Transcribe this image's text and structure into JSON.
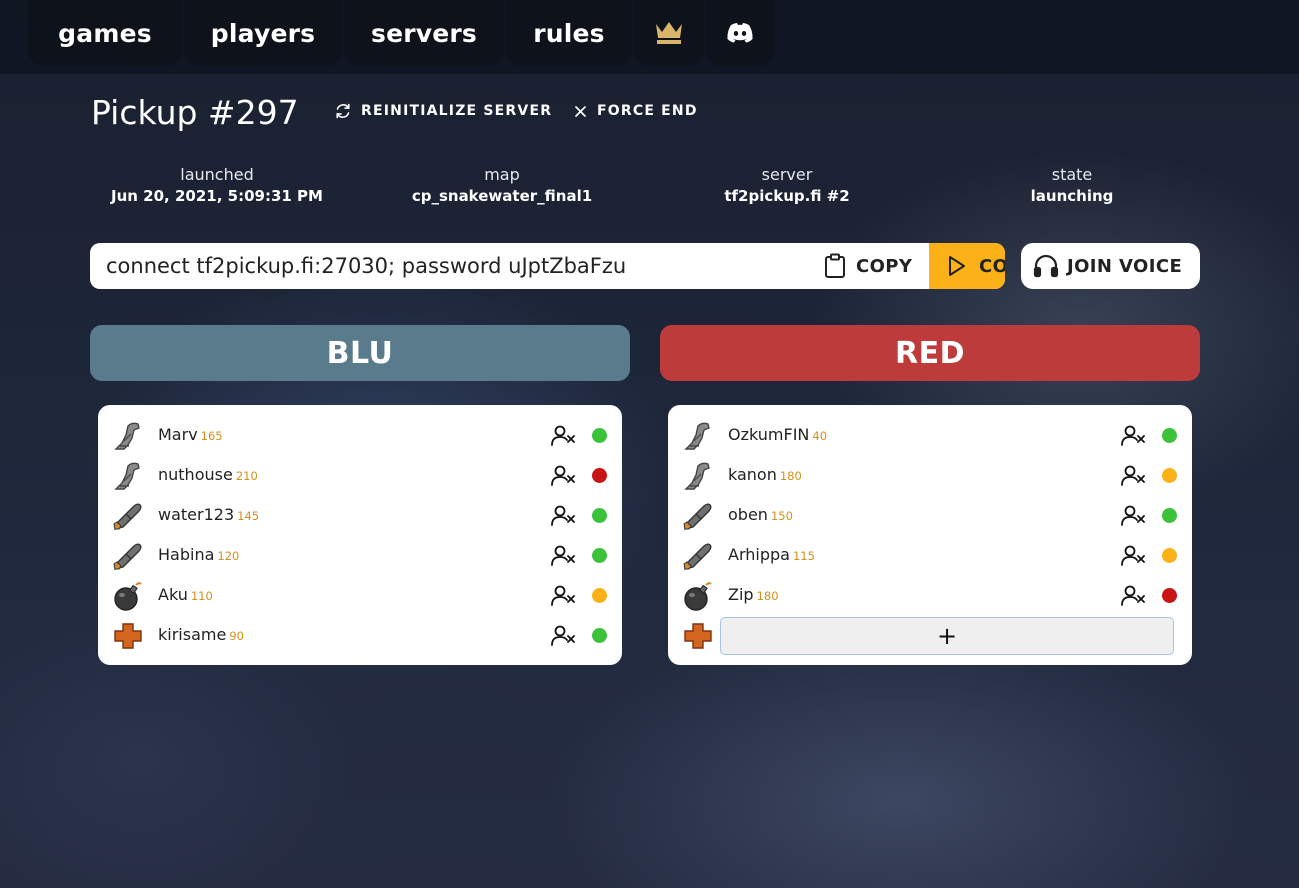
{
  "nav": {
    "items": [
      {
        "label": "games"
      },
      {
        "label": "players"
      },
      {
        "label": "servers"
      },
      {
        "label": "rules"
      }
    ],
    "icons": [
      "crown-icon",
      "discord-icon"
    ],
    "accent": "#d9b56a"
  },
  "game": {
    "title": "Pickup #297",
    "actions": {
      "reinitialize": "REINITIALIZE SERVER",
      "force_end": "FORCE END"
    },
    "meta": [
      {
        "label": "launched",
        "value": "Jun 20, 2021, 5:09:31 PM"
      },
      {
        "label": "map",
        "value": "cp_snakewater_final1"
      },
      {
        "label": "server",
        "value": "tf2pickup.fi #2"
      },
      {
        "label": "state",
        "value": "launching"
      }
    ],
    "connect_string": "connect tf2pickup.fi:27030; password uJptZbaFzu",
    "copy_label": "COPY",
    "connect_label": "CONNECT",
    "voice_label": "JOIN VOICE"
  },
  "colors": {
    "blu": "#5a7b8c",
    "red": "#bd3b3b",
    "connect": "#fbb117",
    "status_green": "#3cc13b",
    "status_red": "#c81414",
    "status_orange": "#fbb117",
    "skill": "#d4901a"
  },
  "teams": [
    {
      "name": "BLU",
      "slots": [
        {
          "class": "scout",
          "name": "Marv",
          "skill": "165",
          "status": "green"
        },
        {
          "class": "scout",
          "name": "nuthouse",
          "skill": "210",
          "status": "red"
        },
        {
          "class": "soldier",
          "name": "water123",
          "skill": "145",
          "status": "green"
        },
        {
          "class": "soldier",
          "name": "Habina",
          "skill": "120",
          "status": "green"
        },
        {
          "class": "demoman",
          "name": "Aku",
          "skill": "110",
          "status": "orange"
        },
        {
          "class": "medic",
          "name": "kirisame",
          "skill": "90",
          "status": "green"
        }
      ]
    },
    {
      "name": "RED",
      "slots": [
        {
          "class": "scout",
          "name": "OzkumFIN",
          "skill": "40",
          "status": "green"
        },
        {
          "class": "scout",
          "name": "kanon",
          "skill": "180",
          "status": "orange"
        },
        {
          "class": "soldier",
          "name": "oben",
          "skill": "150",
          "status": "green"
        },
        {
          "class": "soldier",
          "name": "Arhippa",
          "skill": "115",
          "status": "orange"
        },
        {
          "class": "demoman",
          "name": "Zip",
          "skill": "180",
          "status": "red"
        },
        {
          "class": "medic",
          "name": "",
          "skill": "",
          "status": "empty",
          "add_label": "+"
        }
      ]
    }
  ]
}
